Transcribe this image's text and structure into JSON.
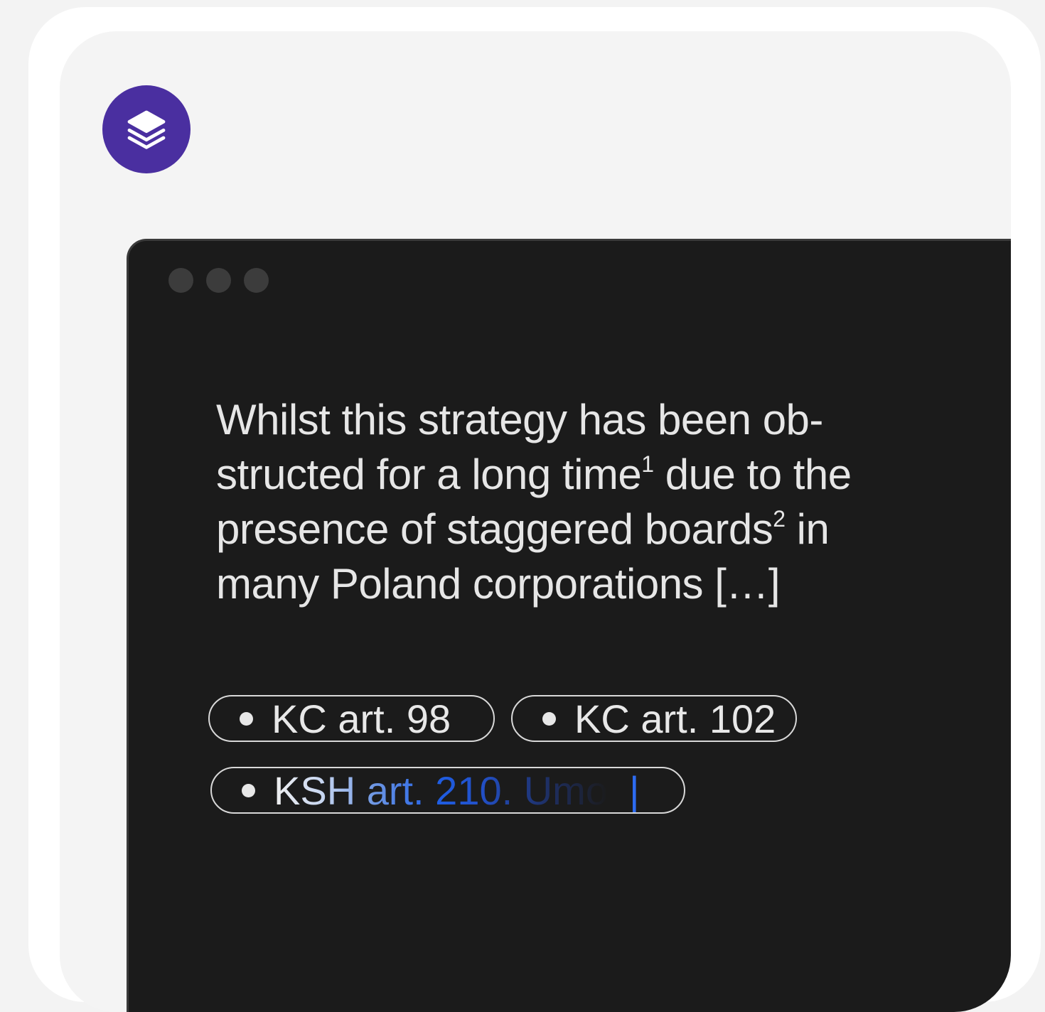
{
  "app": {
    "icon": "layers-icon",
    "icon_color": "#4a2fa0"
  },
  "window": {
    "background": "#1b1b1b",
    "traffic_lights": [
      "window-dot",
      "window-dot",
      "window-dot"
    ]
  },
  "quote": {
    "part1": "Whilst this strategy has been ob-structed for a long time",
    "footnote1": "1",
    "part2": " due to the presence of staggered boards",
    "footnote2": "2",
    "part3": " in many Poland corporations […]"
  },
  "citations": [
    {
      "label": "KC art. 98"
    },
    {
      "label": "KC art. 102"
    },
    {
      "label": "KSH art.  210. Umo",
      "caret": "|"
    }
  ],
  "colors": {
    "accent": "#2d6bf0",
    "text": "#e6e6e6"
  }
}
